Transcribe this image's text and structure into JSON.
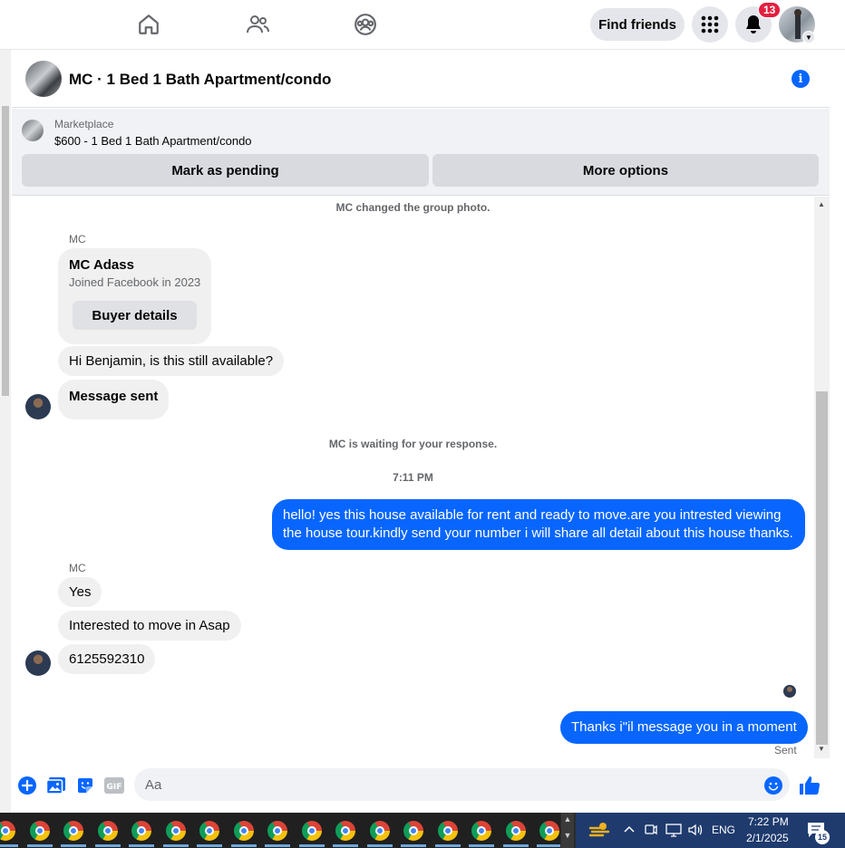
{
  "topnav": {
    "find_friends": "Find friends",
    "notification_count": "13"
  },
  "chat": {
    "title": "MC · 1 Bed 1 Bath Apartment/condo",
    "info_glyph": "i"
  },
  "marketplace": {
    "label": "Marketplace",
    "listing": "$600 - 1 Bed 1 Bath Apartment/condo",
    "mark_pending": "Mark as pending",
    "more_options": "More options"
  },
  "messages": {
    "sys_group_photo": "MC changed the group photo.",
    "sender_1": "MC",
    "card_name": "MC Adass",
    "card_sub": "Joined Facebook in 2023",
    "card_button": "Buyer details",
    "msg_1": "Hi Benjamin, is this still available?",
    "msg_2": "Message sent",
    "sys_waiting": "MC is waiting for your response.",
    "time_1": "7:11 PM",
    "out_1": "hello! yes this house available for rent and ready to move.are you intrested viewing the house tour.kindly send your number i will share all detail about this house thanks.",
    "sender_2": "MC",
    "msg_3": "Yes",
    "msg_4": "Interested to move in Asap",
    "msg_5": "6125592310",
    "out_2": "Thanks i\"il message you in a moment",
    "sent_label": "Sent"
  },
  "composer": {
    "placeholder": "Aa",
    "gif_label": "GIF"
  },
  "taskbar": {
    "language": "ENG",
    "time": "7:22 PM",
    "date": "2/1/2025",
    "notif_count": "15"
  },
  "colors": {
    "accent": "#0866ff",
    "bubble_in": "#f0f0f0",
    "badge": "#e41e3f"
  }
}
